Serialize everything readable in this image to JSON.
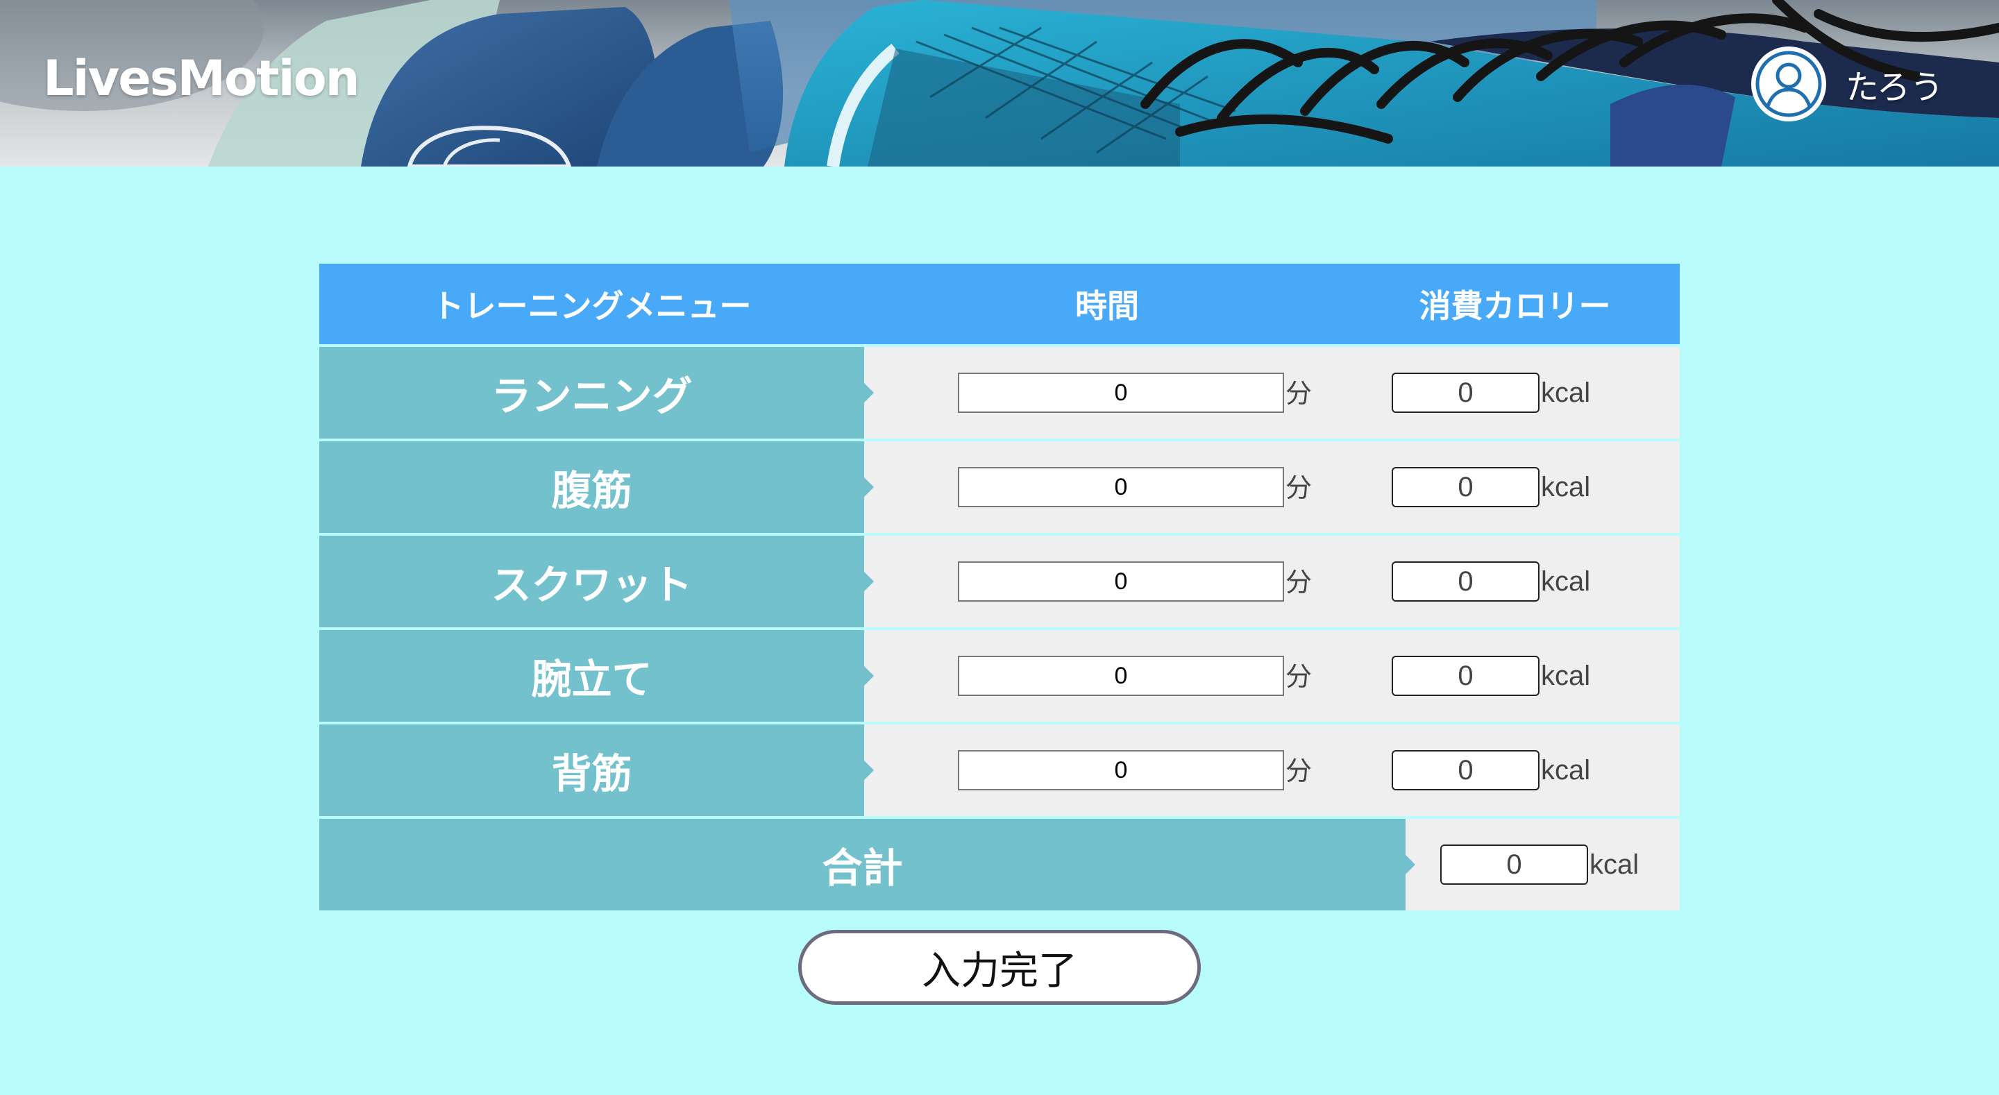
{
  "app": {
    "logo": "LivesMotion",
    "user_name": "たろう"
  },
  "table": {
    "headers": {
      "menu": "トレーニングメニュー",
      "time": "時間",
      "calories": "消費カロリー"
    },
    "rows": [
      {
        "label": "ランニング",
        "minutes": "0",
        "minutes_unit": "分",
        "kcal": "0",
        "kcal_unit": "kcal"
      },
      {
        "label": "腹筋",
        "minutes": "0",
        "minutes_unit": "分",
        "kcal": "0",
        "kcal_unit": "kcal"
      },
      {
        "label": "スクワット",
        "minutes": "0",
        "minutes_unit": "分",
        "kcal": "0",
        "kcal_unit": "kcal"
      },
      {
        "label": "腕立て",
        "minutes": "0",
        "minutes_unit": "分",
        "kcal": "0",
        "kcal_unit": "kcal"
      },
      {
        "label": "背筋",
        "minutes": "0",
        "minutes_unit": "分",
        "kcal": "0",
        "kcal_unit": "kcal"
      }
    ],
    "total": {
      "label": "合計",
      "kcal": "0",
      "kcal_unit": "kcal"
    }
  },
  "submit_label": "入力完了",
  "colors": {
    "page_bg": "#b8fcfb",
    "header_bar": "#47a9f8",
    "row_label_bg": "#73c1cd",
    "row_body_bg": "#efefef",
    "avatar_icon": "#1d6fb0"
  },
  "icons": {
    "user": "user-avatar-icon"
  }
}
